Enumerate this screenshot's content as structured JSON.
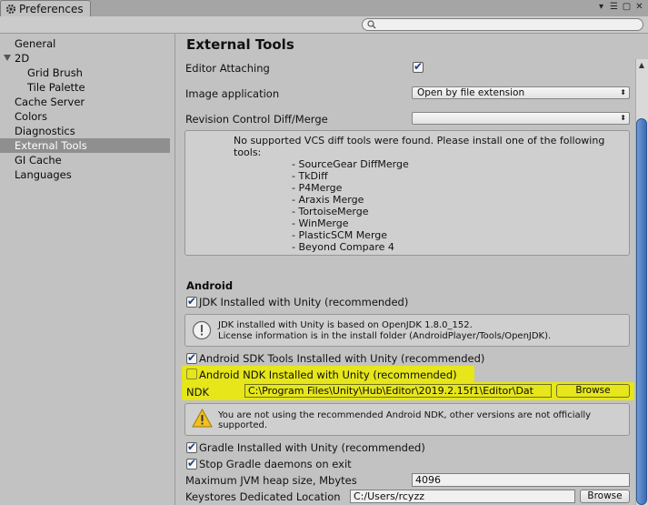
{
  "window": {
    "tab_title": "Preferences",
    "controls": [
      "▾",
      "☰",
      "▢",
      "✕"
    ]
  },
  "search": {
    "placeholder": ""
  },
  "sidebar": {
    "items": [
      {
        "label": "General"
      },
      {
        "label": "2D"
      },
      {
        "label": "Grid Brush"
      },
      {
        "label": "Tile Palette"
      },
      {
        "label": "Cache Server"
      },
      {
        "label": "Colors"
      },
      {
        "label": "Diagnostics"
      },
      {
        "label": "External Tools",
        "selected": true
      },
      {
        "label": "GI Cache"
      },
      {
        "label": "Languages"
      }
    ]
  },
  "main": {
    "title": "External Tools",
    "editor_attaching": {
      "label": "Editor Attaching",
      "checked": true
    },
    "image_application": {
      "label": "Image application",
      "value": "Open by file extension"
    },
    "revision_control": {
      "label": "Revision Control Diff/Merge",
      "value": ""
    },
    "vcs_message": {
      "text": "No supported VCS diff tools were found. Please install one of the following",
      "text2": "tools:",
      "tools": [
        "- SourceGear DiffMerge",
        "- TkDiff",
        "- P4Merge",
        "- Araxis Merge",
        "- TortoiseMerge",
        "- WinMerge",
        "- PlasticSCM Merge",
        "- Beyond Compare 4"
      ]
    },
    "android": {
      "section_title": "Android",
      "jdk": {
        "label": "JDK Installed with Unity (recommended)",
        "checked": true
      },
      "jdk_info": {
        "line1": "JDK installed with Unity is based on OpenJDK 1.8.0_152.",
        "line2": "License information is in the install folder (AndroidPlayer/Tools/OpenJDK)."
      },
      "sdk": {
        "label": "Android SDK Tools Installed with Unity (recommended)",
        "checked": true
      },
      "ndk": {
        "label": "Android NDK Installed with Unity (recommended)",
        "checked": false
      },
      "ndk_path": {
        "label": "NDK",
        "value": "C:\\Program Files\\Unity\\Hub\\Editor\\2019.2.15f1\\Editor\\Dat",
        "browse": "Browse"
      },
      "ndk_warning": {
        "line1": "You are not using the recommended Android NDK, other versions are not officially",
        "line2": "supported."
      },
      "gradle": {
        "label": "Gradle Installed with Unity (recommended)",
        "checked": true
      },
      "stop_gradle": {
        "label": "Stop Gradle daemons on exit",
        "checked": true
      },
      "jvm_heap": {
        "label": "Maximum JVM heap size, Mbytes",
        "value": "4096"
      },
      "keystores": {
        "label": "Keystores Dedicated Location",
        "value": "C:/Users/rcyzz",
        "browse": "Browse"
      }
    }
  },
  "colors": {
    "highlight": "#e6e61a",
    "selection": "#8f8f8f",
    "scroll_thumb": "#4a78c0"
  }
}
